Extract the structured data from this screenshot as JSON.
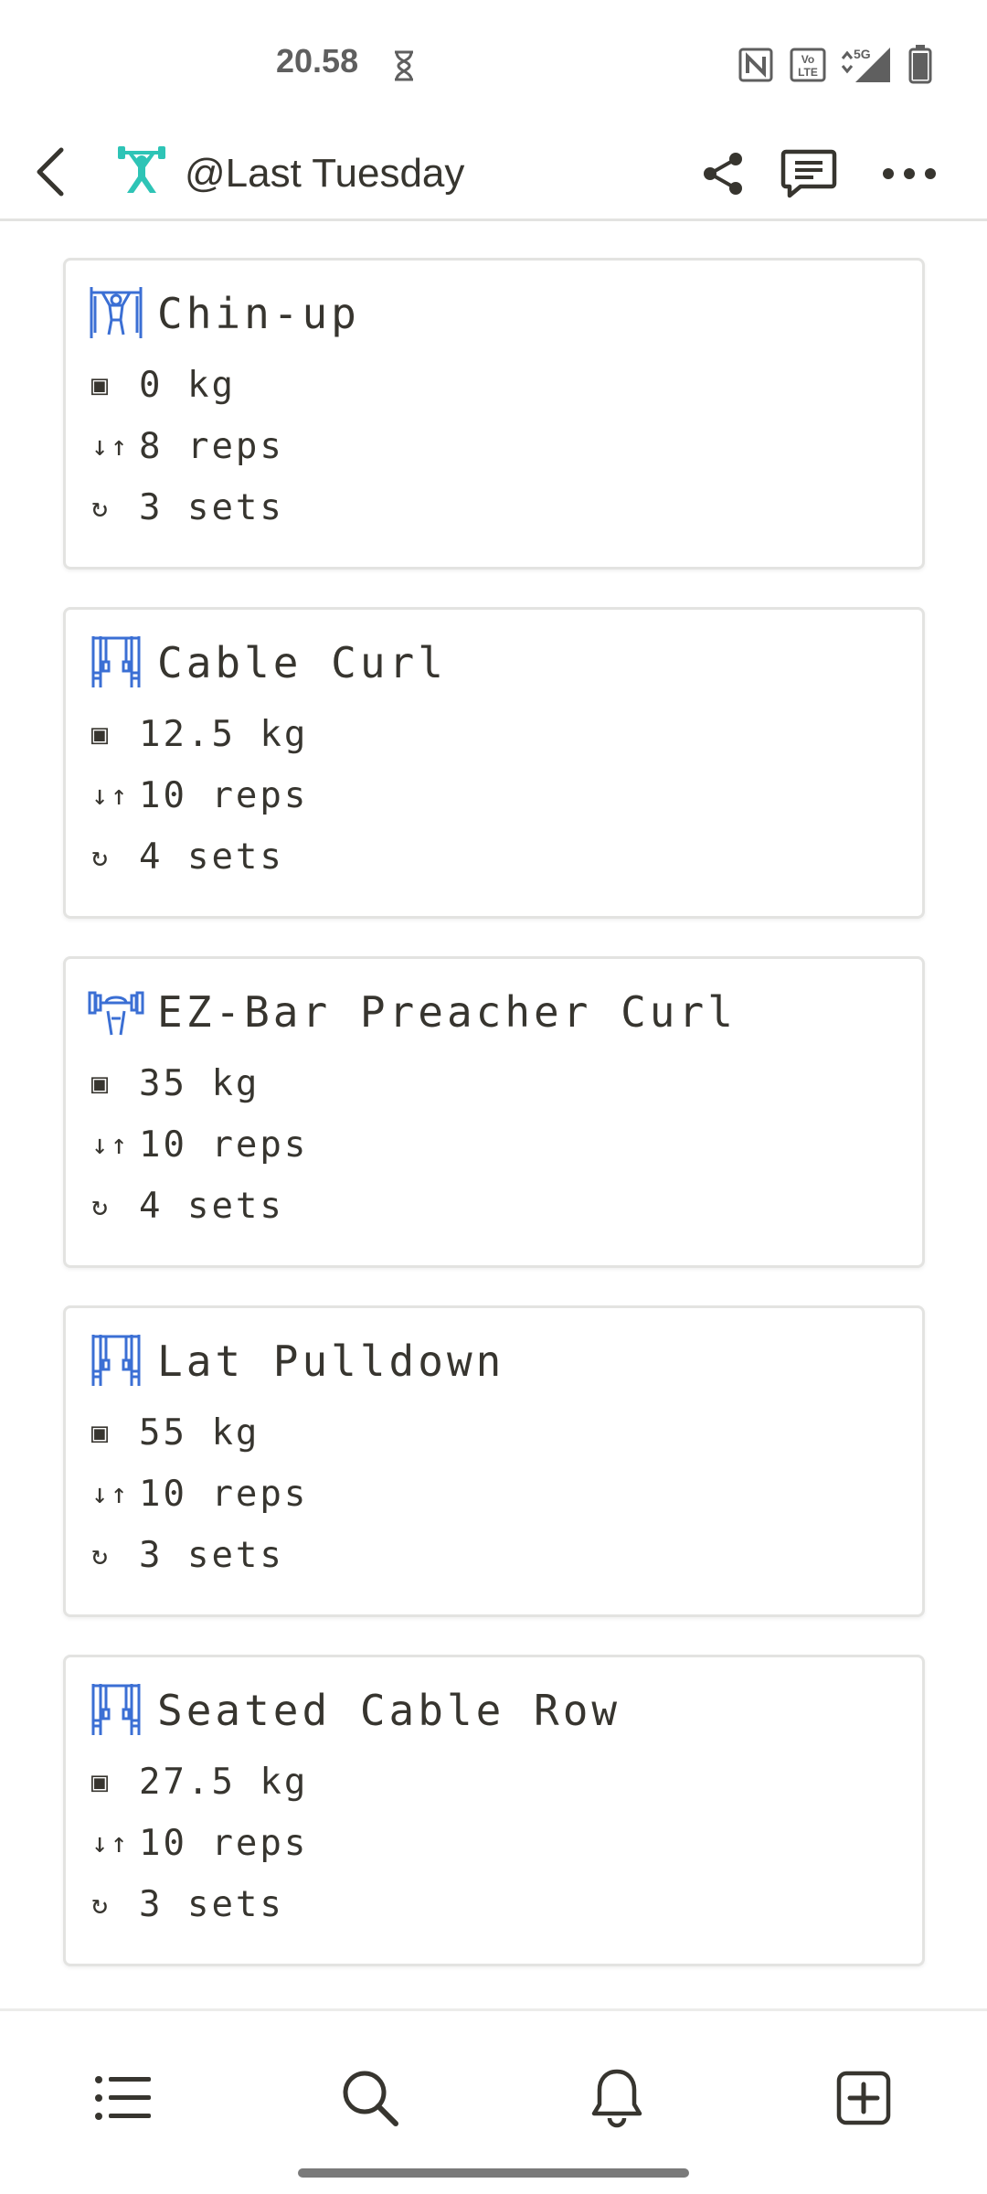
{
  "status_bar": {
    "time": "20.58",
    "icons": [
      "hourglass-icon",
      "nfc-icon",
      "volte-icon",
      "5g-signal-icon",
      "battery-icon"
    ]
  },
  "header": {
    "title": "@Last Tuesday",
    "page_icon": "weightlifter-icon",
    "accent_color": "#2ec4b6",
    "actions": [
      "back-icon",
      "share-icon",
      "comment-icon",
      "more-icon"
    ]
  },
  "exercises": [
    {
      "name": "Chin-up",
      "icon": "pull-up-bar-icon",
      "weight": "0 kg",
      "reps": "8 reps",
      "sets": "3 sets"
    },
    {
      "name": "Cable Curl",
      "icon": "cable-machine-icon",
      "weight": "12.5 kg",
      "reps": "10 reps",
      "sets": "4 sets"
    },
    {
      "name": "EZ-Bar Preacher Curl",
      "icon": "barbell-icon",
      "weight": "35 kg",
      "reps": "10 reps",
      "sets": "4 sets"
    },
    {
      "name": "Lat Pulldown",
      "icon": "cable-machine-icon",
      "weight": "55 kg",
      "reps": "10 reps",
      "sets": "3 sets"
    },
    {
      "name": "Seated Cable Row",
      "icon": "cable-machine-icon",
      "weight": "27.5 kg",
      "reps": "10 reps",
      "sets": "3 sets"
    }
  ],
  "stat_glyphs": {
    "weight": "▣",
    "reps": "↓↑",
    "sets": "↻"
  },
  "bottom_nav": [
    "list-icon",
    "search-icon",
    "bell-icon",
    "new-page-icon"
  ],
  "colors": {
    "exercise_icon": "#3b6fd4",
    "text": "#37352f",
    "border": "#e3e3e1"
  }
}
